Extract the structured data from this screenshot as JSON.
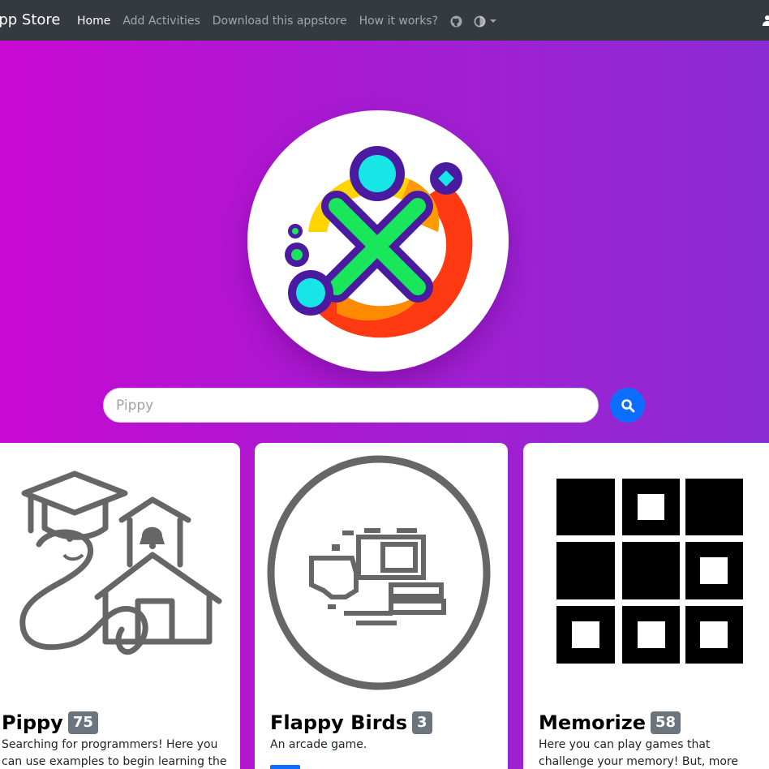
{
  "navbar": {
    "brand": "App Store",
    "links": [
      "Home",
      "Add Activities",
      "Download this appstore",
      "How it works?"
    ],
    "icons": [
      "github-icon",
      "theme-toggle-icon"
    ]
  },
  "hero": {
    "logo_icon": "sugar-labs-x-logo",
    "search": {
      "placeholder": "Pippy",
      "value": ""
    },
    "search_icon": "search-icon"
  },
  "colors": {
    "navbar": "#343a40",
    "gradient_start": "#c809d3",
    "gradient_end": "#8c2cd3",
    "search_button": "#0d6efd",
    "badge": "#6c757d"
  },
  "activities": [
    {
      "name": "Pippy",
      "count": "75",
      "description": "Searching for programmers! Here you can use examples to begin learning the",
      "icon": "pippy-snake-school-icon"
    },
    {
      "name": "Flappy Birds",
      "count": "3",
      "description": "An arcade game.",
      "icon": "flappy-birds-icon"
    },
    {
      "name": "Memorize",
      "count": "58",
      "description": "Here you can play games that challenge your memory! But, more importantly,",
      "icon": "memorize-grid-icon"
    }
  ]
}
